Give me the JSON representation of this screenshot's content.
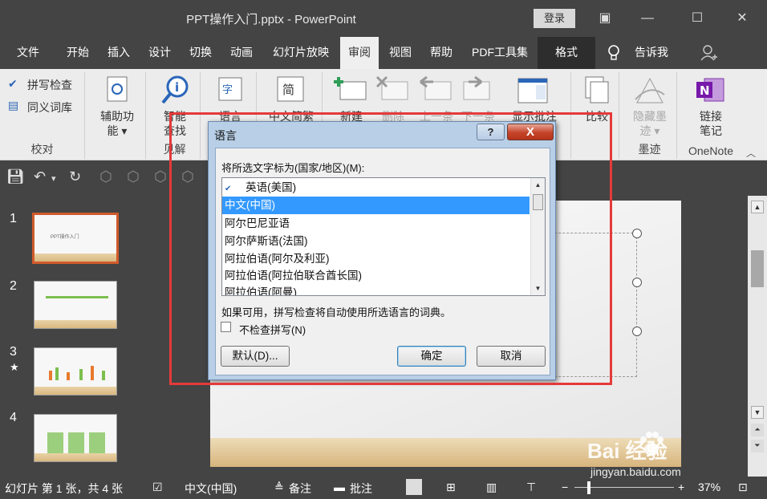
{
  "window": {
    "title": "PPT操作入门.pptx  -  PowerPoint",
    "login": "登录"
  },
  "menu": {
    "items": [
      "文件",
      "开始",
      "插入",
      "设计",
      "切换",
      "动画",
      "幻灯片放映",
      "审阅",
      "视图",
      "帮助",
      "PDF工具集",
      "格式",
      "告诉我"
    ]
  },
  "ribbon": {
    "proofing": {
      "spell": "拼写检查",
      "thesaurus": "同义词库",
      "group": "校对"
    },
    "accessibility": {
      "check": "辅助功\n能 ▾"
    },
    "insights": {
      "smart": "智能\n查找",
      "group": "见解"
    },
    "language": {
      "lang": "语言"
    },
    "chinese": {
      "conv": "中文简繁"
    },
    "comments": {
      "new": "新建",
      "delete": "删除",
      "prev": "上一条",
      "next": "下一条",
      "show": "显示批注"
    },
    "compare": {
      "label": "比较"
    },
    "ink": {
      "hide": "隐藏墨\n迹 ▾",
      "group": "墨迹"
    },
    "onenote": {
      "link": "链接\n笔记",
      "group": "OneNote"
    }
  },
  "thumbnails": [
    {
      "num": "1",
      "title": "PPT操作入门"
    },
    {
      "num": "2"
    },
    {
      "num": "3"
    },
    {
      "num": "4"
    }
  ],
  "statusbar": {
    "slide": "幻灯片 第 1 张，共 4 张",
    "lang": "中文(中国)",
    "notes": "备注",
    "comments": "批注",
    "zoom": "37%"
  },
  "dialog": {
    "title": "语言",
    "help": "?",
    "close": "X",
    "prompt": "将所选文字标为(国家/地区)(M):",
    "languages": [
      "英语(美国)",
      "中文(中国)",
      "阿尔巴尼亚语",
      "阿尔萨斯语(法国)",
      "阿拉伯语(阿尔及利亚)",
      "阿拉伯语(阿拉伯联合酋长国)",
      "阿拉伯语(阿曼)"
    ],
    "selected_index": 1,
    "info": "如果可用，拼写检查将自动使用所选语言的词典。",
    "no_check": "不检查拼写(N)",
    "default_btn": "默认(D)...",
    "ok_btn": "确定",
    "cancel_btn": "取消"
  },
  "watermark": {
    "brand": "Bai 经验",
    "url": "jingyan.baidu.com"
  },
  "colors": {
    "accent": "#d05a2c",
    "highlight": "#e53a3a",
    "selection": "#3399ff"
  }
}
